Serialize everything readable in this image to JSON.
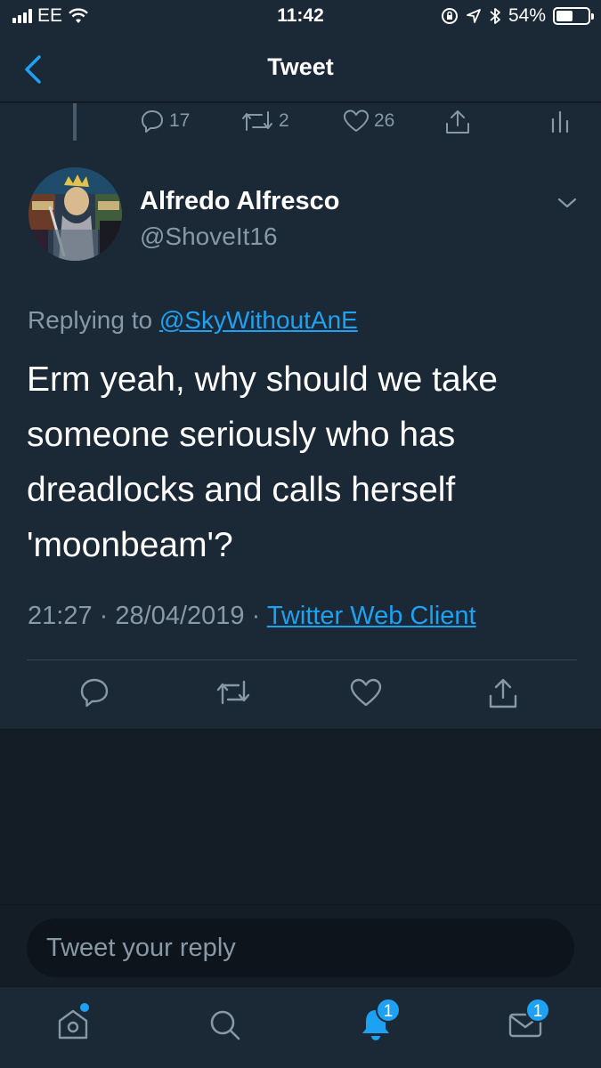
{
  "status_bar": {
    "carrier": "EE",
    "time": "11:42",
    "battery_percent_label": "54%",
    "battery_level": 0.54
  },
  "nav": {
    "title": "Tweet"
  },
  "previous_tweet_actions": {
    "reply_count": "17",
    "retweet_count": "2",
    "like_count": "26"
  },
  "tweet": {
    "display_name": "Alfredo Alfresco",
    "handle": "@ShoveIt16",
    "replying_to_label": "Replying to",
    "replying_to_handle": "@SkyWithoutAnE",
    "text": "Erm yeah, why should we take someone seriously who has dreadlocks and calls herself 'moonbeam'?",
    "time": "21:27",
    "separator": "·",
    "date": "28/04/2019",
    "client": "Twitter Web Client"
  },
  "reply": {
    "placeholder": "Tweet your reply"
  },
  "tabbar": {
    "notifications_badge": "1",
    "messages_badge": "1"
  },
  "colors": {
    "background": "#1b2836",
    "accent": "#1da1f2",
    "secondary_text": "#8899a6"
  }
}
